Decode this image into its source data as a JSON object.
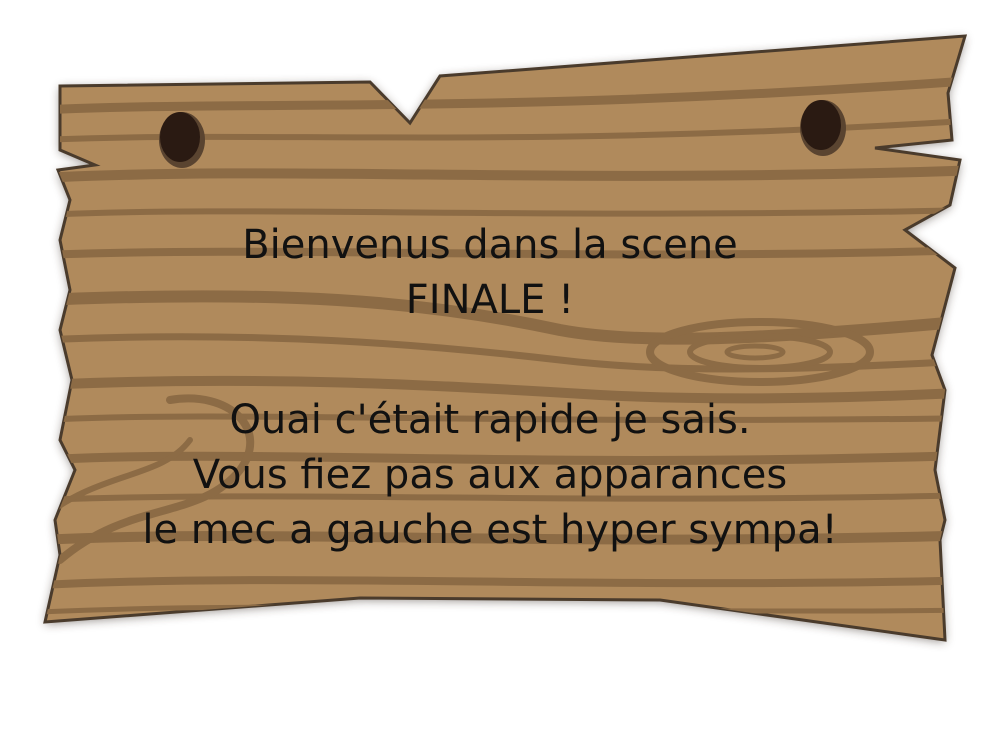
{
  "sign": {
    "lines": [
      "Bienvenus dans la scene",
      "FINALE !",
      "Ouai c'était rapide je sais.",
      "Vous fiez pas aux apparances",
      "le mec a gauche est hyper sympa!"
    ]
  },
  "colors": {
    "wood_light": "#b08a5c",
    "wood_dark": "#8a6a44",
    "wood_outline": "#3a2f25",
    "hole": "#2a1a12",
    "text": "#111111"
  }
}
